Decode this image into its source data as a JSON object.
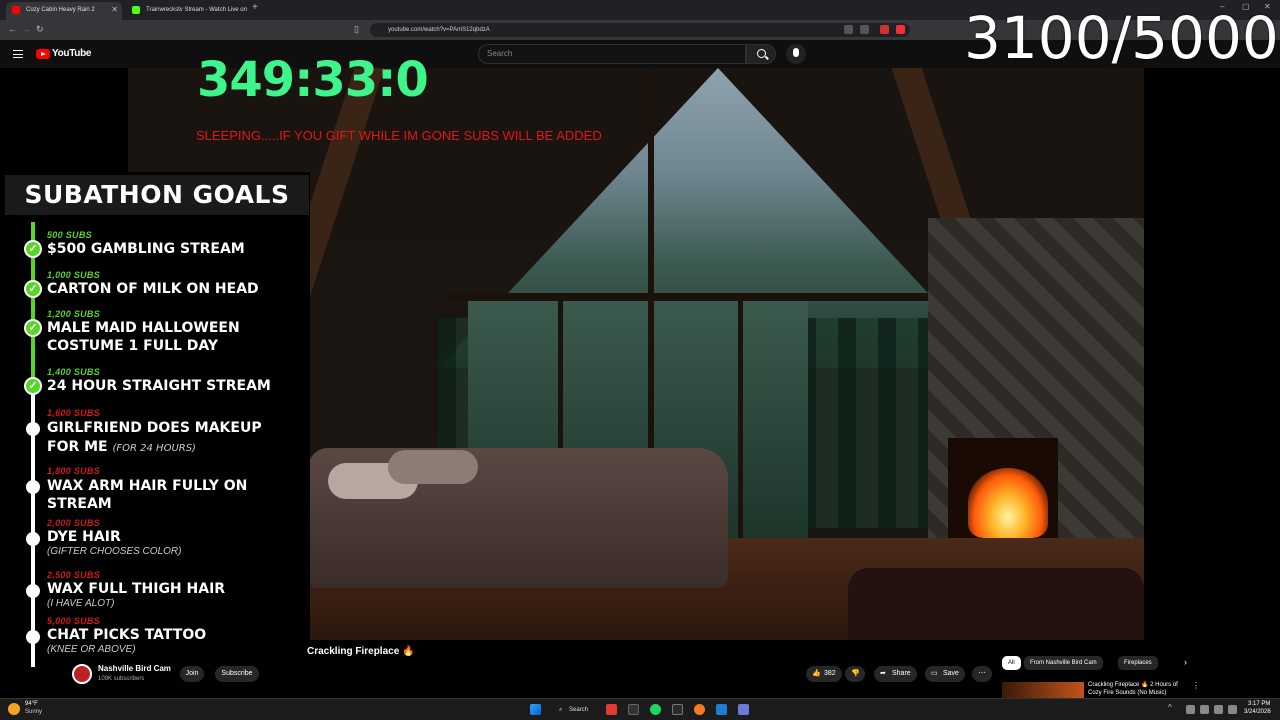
{
  "browser": {
    "tabs": [
      {
        "title": "Cozy Cabin Heavy Rain 2",
        "active": true
      },
      {
        "title": "Trainwreckstv Stream - Watch Live on",
        "active": false
      }
    ],
    "url": "youtube.com/watch?v=PAmS12qbdzA"
  },
  "youtube": {
    "logo_text": "YouTube",
    "search_placeholder": "Search"
  },
  "overlay": {
    "timer": "349:33:0",
    "sleeping_message": "SLEEPING.....IF YOU GIFT WHILE IM GONE SUBS WILL BE ADDED",
    "sub_counter": "3100/5000"
  },
  "goals_panel": {
    "title": "SUBATHON GOALS",
    "goals": [
      {
        "requirement": "500 SUBS",
        "name": "$500 GAMBLING STREAM",
        "done": true
      },
      {
        "requirement": "1,000 SUBS",
        "name": "CARTON OF MILK ON HEAD",
        "done": true
      },
      {
        "requirement": "1,200 SUBS",
        "name": "MALE MAID HALLOWEEN",
        "name2": "COSTUME 1 FULL DAY",
        "done": true
      },
      {
        "requirement": "1,400 SUBS",
        "name": "24 HOUR STRAIGHT STREAM",
        "done": true
      },
      {
        "requirement": "1,600 SUBS",
        "name": "GIRLFRIEND DOES MAKEUP",
        "name2": "FOR ME",
        "note": "(FOR 24 HOURS)",
        "done": false
      },
      {
        "requirement": "1,800 SUBS",
        "name": "WAX ARM HAIR FULLY ON",
        "name2": "STREAM",
        "done": false
      },
      {
        "requirement": "2,000 SUBS",
        "name": "DYE HAIR",
        "sub": "(GIFTER CHOOSES COLOR)",
        "done": false
      },
      {
        "requirement": "2,500 SUBS",
        "name": "WAX FULL THIGH HAIR",
        "sub": "(I HAVE ALOT)",
        "done": false
      },
      {
        "requirement": "5,000 SUBS",
        "name": "CHAT PICKS TATTOO",
        "sub": "(KNEE OR ABOVE)",
        "done": false
      }
    ]
  },
  "video_info": {
    "title": "Crackling Fireplace 🔥",
    "channel_name": "Nashville Bird Cam",
    "channel_subs": "109K subscribers",
    "join_label": "Join",
    "subscribe_label": "Subscribe",
    "like_count": "382",
    "share_label": "Share",
    "save_label": "Save"
  },
  "recommendations": {
    "chips": [
      "All",
      "From Nashville Bird Cam",
      "Fireplaces"
    ],
    "first_title": "Crackling Fireplace 🔥 2 Hours of Cozy Fire Sounds (No Music)"
  },
  "taskbar": {
    "weather_temp": "94°F",
    "weather_condition": "Sunny",
    "search_label": "Search",
    "time": "3:17 PM",
    "date": "3/24/2026"
  },
  "colors": {
    "timer": "#3df58b",
    "goal_done": "#57d626",
    "goal_todo_requirement": "#d01818",
    "sleeping_text": "#e01616",
    "youtube_red": "#ff0000"
  }
}
